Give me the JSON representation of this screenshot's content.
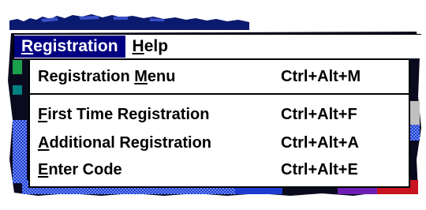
{
  "menubar": {
    "items": [
      {
        "mnemonic": "R",
        "rest": "egistration"
      },
      {
        "mnemonic": "H",
        "rest": "elp"
      }
    ]
  },
  "registration_menu": {
    "items": [
      {
        "pre": "Registration ",
        "mnemonic": "M",
        "post": "enu",
        "shortcut": "Ctrl+Alt+M"
      },
      {
        "pre": "",
        "mnemonic": "F",
        "post": "irst Time Registration",
        "shortcut": "Ctrl+Alt+F"
      },
      {
        "pre": "",
        "mnemonic": "A",
        "post": "dditional Registration",
        "shortcut": "Ctrl+Alt+A"
      },
      {
        "pre": "",
        "mnemonic": "E",
        "post": "nter Code",
        "shortcut": "Ctrl+Alt+E"
      }
    ]
  },
  "colors": {
    "menu_highlight": "#000080",
    "highlight_text": "#ffffff",
    "background_teal": "#008080",
    "background_blue": "#1e3cd2",
    "background_red": "#c8141e",
    "background_purple": "#6e1eb4"
  }
}
